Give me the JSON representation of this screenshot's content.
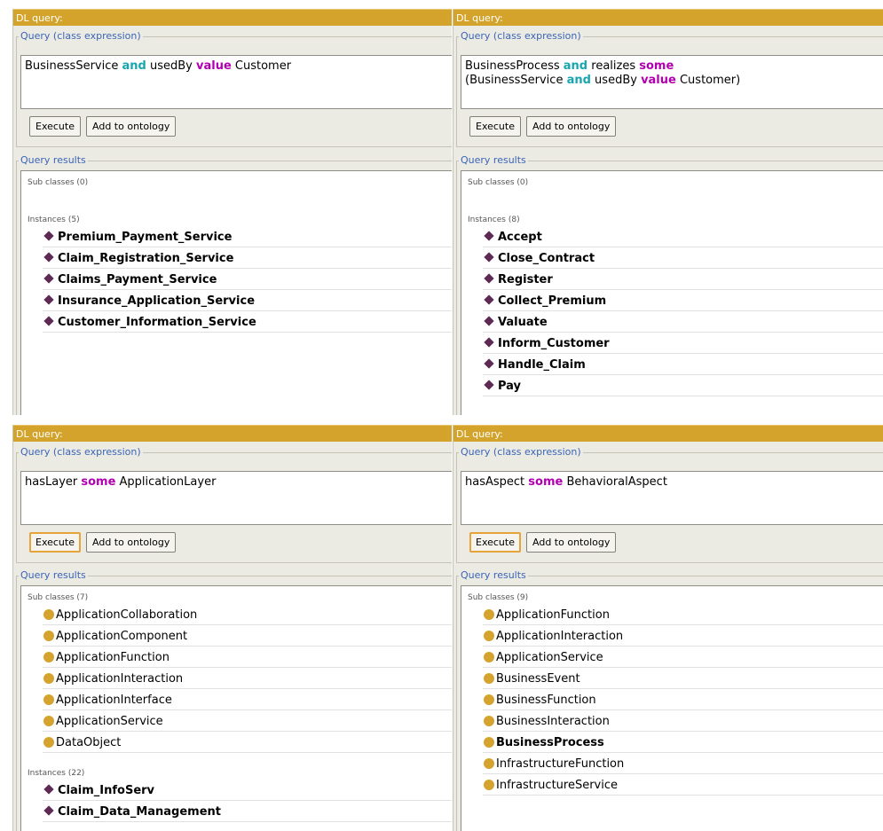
{
  "panels": [
    {
      "title": "DL query:",
      "query_legend": "Query (class expression)",
      "query_lines": [
        [
          [
            "BusinessService ",
            "n"
          ],
          [
            "and",
            "c"
          ],
          [
            " usedBy ",
            "n"
          ],
          [
            "value",
            "m"
          ],
          [
            " Customer",
            "n"
          ]
        ]
      ],
      "execute_label": "Execute",
      "add_label": "Add to ontology",
      "execute_focused": false,
      "results_legend": "Query results",
      "sections": [
        {
          "header": "Sub classes (0)",
          "kind": "class",
          "items": []
        },
        {
          "header": "Instances (5)",
          "kind": "instance",
          "items": [
            "Premium_Payment_Service",
            "Claim_Registration_Service",
            "Claims_Payment_Service",
            "Insurance_Application_Service",
            "Customer_Information_Service"
          ]
        }
      ]
    },
    {
      "title": "DL query:",
      "query_legend": "Query (class expression)",
      "query_lines": [
        [
          [
            "BusinessProcess ",
            "n"
          ],
          [
            "and",
            "c"
          ],
          [
            " realizes ",
            "n"
          ],
          [
            "some",
            "m"
          ]
        ],
        [
          [
            "(BusinessService ",
            "n"
          ],
          [
            "and",
            "c"
          ],
          [
            " usedBy ",
            "n"
          ],
          [
            "value",
            "m"
          ],
          [
            " Customer)",
            "n"
          ]
        ]
      ],
      "execute_label": "Execute",
      "add_label": "Add to ontology",
      "execute_focused": false,
      "results_legend": "Query results",
      "sections": [
        {
          "header": "Sub classes (0)",
          "kind": "class",
          "items": []
        },
        {
          "header": "Instances (8)",
          "kind": "instance",
          "items": [
            "Accept",
            "Close_Contract",
            "Register",
            "Collect_Premium",
            "Valuate",
            "Inform_Customer",
            "Handle_Claim",
            "Pay"
          ]
        }
      ]
    },
    {
      "title": "DL query:",
      "query_legend": "Query (class expression)",
      "query_lines": [
        [
          [
            "hasLayer ",
            "n"
          ],
          [
            "some",
            "m"
          ],
          [
            " ApplicationLayer",
            "n"
          ]
        ]
      ],
      "execute_label": "Execute",
      "add_label": "Add to ontology",
      "execute_focused": true,
      "results_legend": "Query results",
      "sections": [
        {
          "header": "Sub classes (7)",
          "kind": "class",
          "items": [
            "ApplicationCollaboration",
            "ApplicationComponent",
            "ApplicationFunction",
            "ApplicationInteraction",
            "ApplicationInterface",
            "ApplicationService",
            "DataObject"
          ]
        },
        {
          "header": "Instances (22)",
          "kind": "instance",
          "items": [
            "Claim_InfoServ",
            "Claim_Data_Management"
          ]
        }
      ]
    },
    {
      "title": "DL query:",
      "query_legend": "Query (class expression)",
      "query_lines": [
        [
          [
            "hasAspect ",
            "n"
          ],
          [
            "some",
            "m"
          ],
          [
            " BehavioralAspect",
            "n"
          ]
        ]
      ],
      "execute_label": "Execute",
      "add_label": "Add to ontology",
      "execute_focused": true,
      "results_legend": "Query results",
      "sections": [
        {
          "header": "Sub classes (9)",
          "kind": "class",
          "items": [
            "ApplicationFunction",
            "ApplicationInteraction",
            "ApplicationService",
            "BusinessEvent",
            "BusinessFunction",
            "BusinessInteraction",
            "BusinessProcess",
            "InfrastructureFunction",
            "InfrastructureService"
          ],
          "bold_items": [
            "BusinessProcess"
          ]
        }
      ]
    }
  ],
  "colors": {
    "title_bar": "#d4a32c",
    "keyword_cyan": "#17a5b0",
    "keyword_magenta": "#b000b0",
    "instance_icon": "#5e2a55",
    "class_icon": "#d5a32e"
  },
  "icons": {
    "instance": "diamond-icon",
    "class": "circle-icon"
  }
}
